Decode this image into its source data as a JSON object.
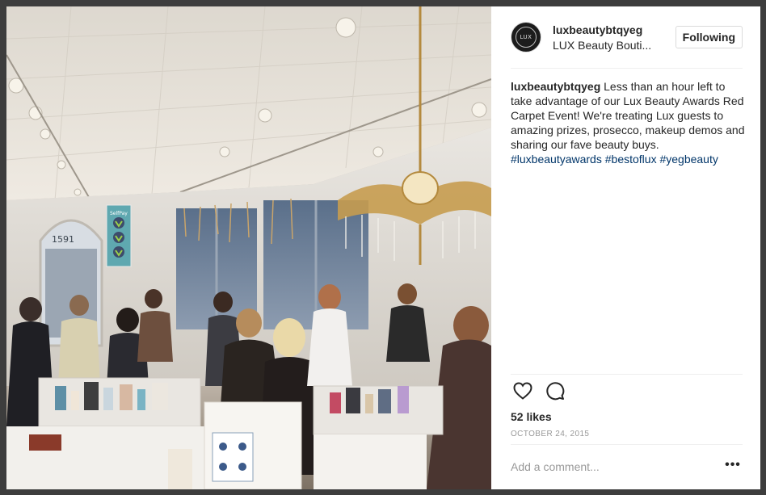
{
  "post": {
    "username": "luxbeautybtqyeg",
    "location": "LUX Beauty Bouti...",
    "follow_label": "Following",
    "caption": {
      "user": "luxbeautybtqyeg",
      "text": " Less than an hour left to take advantage of our Lux Beauty Awards Red Carpet Event! We're treating Lux guests to amazing prizes, prosecco, makeup demos and sharing our fave beauty buys. ",
      "hashtags": [
        "#luxbeautyawards",
        "#bestoflux",
        "#yegbeauty"
      ]
    },
    "likes": "52 likes",
    "date": "OCTOBER 24, 2015",
    "comment_placeholder": "Add a comment...",
    "more_label": "•••",
    "avatar_text": "LUX"
  },
  "store_sign": {
    "top": "SelfPay"
  },
  "window_text": "1591",
  "colors": {
    "text": "#262626",
    "hashtag": "#003569",
    "muted": "#999999",
    "border": "#efefef"
  },
  "icons": {
    "like": "heart-icon",
    "comment": "comment-icon",
    "more": "more-options-icon"
  }
}
